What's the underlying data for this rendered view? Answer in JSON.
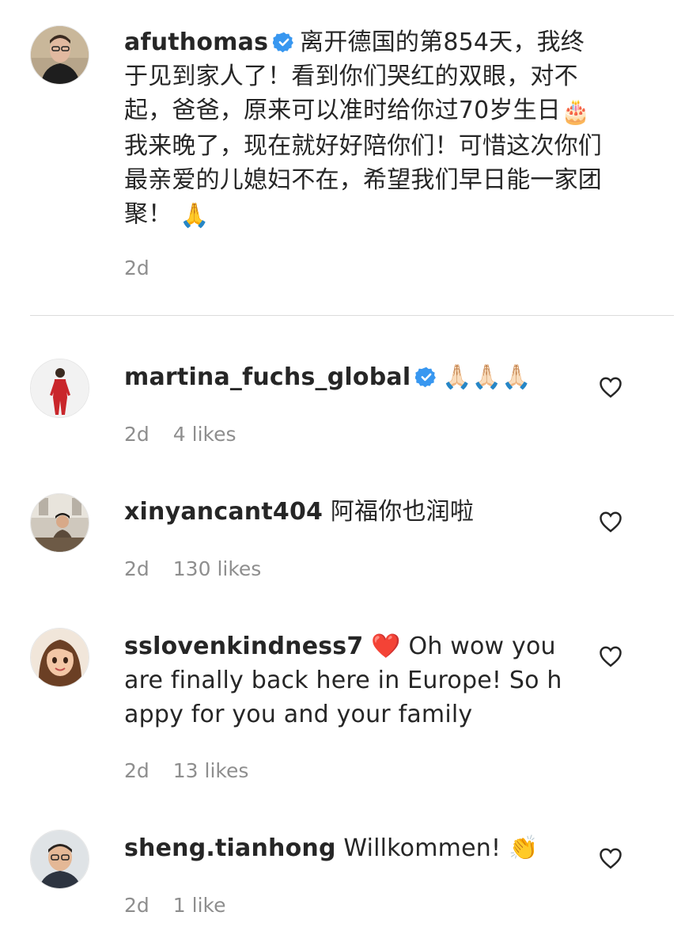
{
  "caption": {
    "username": "afuthomas",
    "verified": true,
    "text_part1": "离开德国的第854天，我终于见到家人了！看到你们哭红的双眼，对不起，爸爸，原来可以准时给你过70岁生日",
    "emoji_cake": "🎂",
    "text_part2": "我来晚了，现在就好好陪你们！可惜这次你们最亲爱的儿媳妇不在，希望我们早日能一家团聚！",
    "emoji_end": "🙏",
    "timestamp": "2d"
  },
  "comments": [
    {
      "username": "martina_fuchs_global",
      "verified": true,
      "text": "🙏🏻🙏🏻🙏🏻",
      "timestamp": "2d",
      "likes": "4 likes"
    },
    {
      "username": "xinyancant404",
      "verified": false,
      "text": "阿福你也润啦",
      "timestamp": "2d",
      "likes": "130 likes"
    },
    {
      "username": "sslovenkindness7",
      "verified": false,
      "emoji": "❤️",
      "text": "Oh wow you are finally back here in Europe! So happy for you and your family",
      "timestamp": "2d",
      "likes": "13 likes"
    },
    {
      "username": "sheng.tianhong",
      "verified": false,
      "text": "Willkommen!",
      "emoji": "👏",
      "timestamp": "2d",
      "likes": "1 like"
    }
  ],
  "colors": {
    "text": "#262626",
    "meta": "#8e8e8e",
    "verified": "#3897f0",
    "divider": "#dbdbdb",
    "heart": "#262626"
  },
  "icons": {
    "verified": "verified-badge-icon",
    "like": "heart-outline-icon"
  }
}
